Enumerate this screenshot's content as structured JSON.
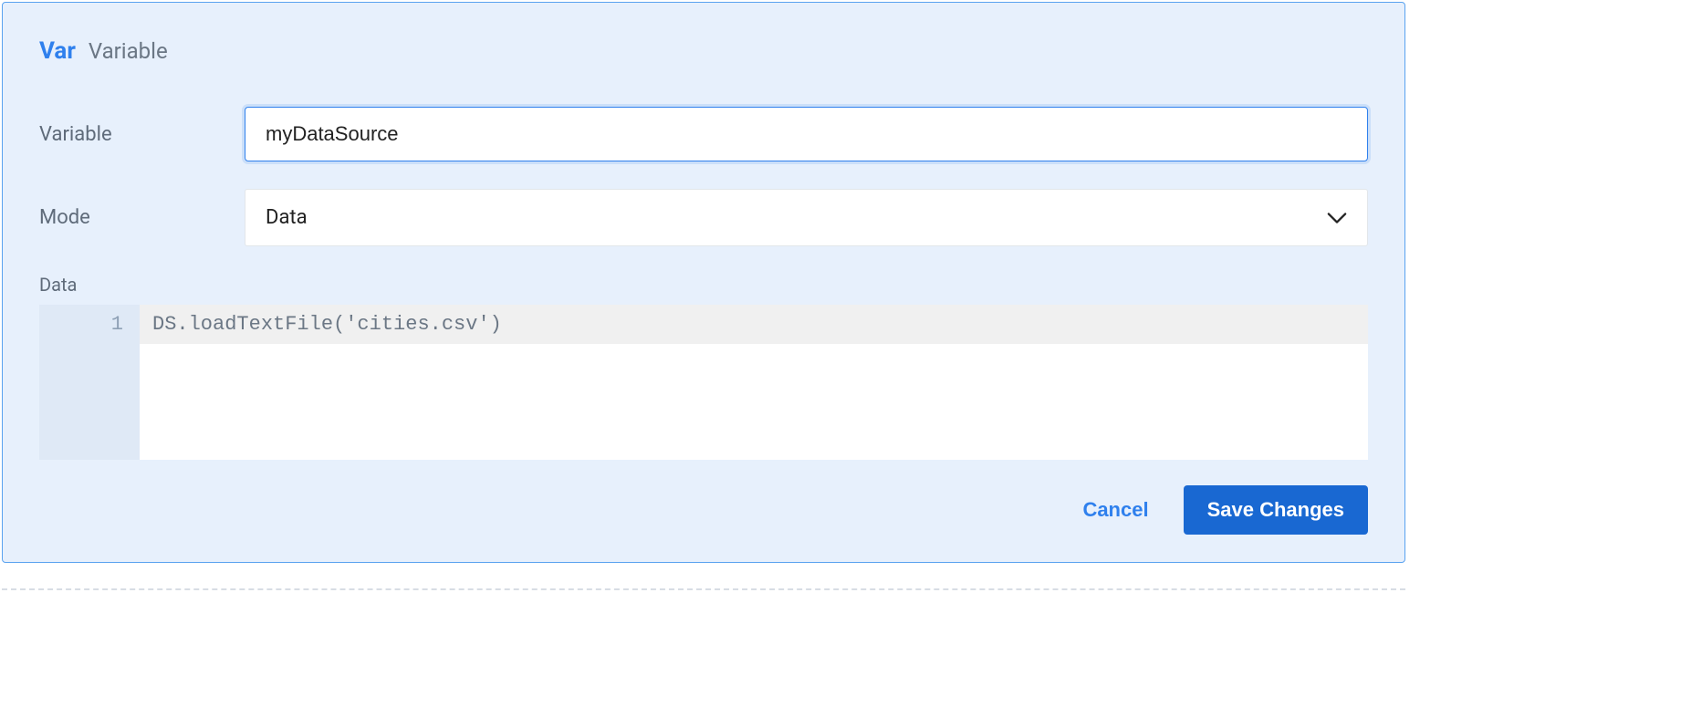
{
  "header": {
    "tag": "Var",
    "subtitle": "Variable"
  },
  "form": {
    "variable_label": "Variable",
    "variable_value": "myDataSource",
    "mode_label": "Mode",
    "mode_value": "Data",
    "data_label": "Data"
  },
  "editor": {
    "gutter": [
      "1"
    ],
    "lines": [
      "DS.loadTextFile('cities.csv')"
    ]
  },
  "actions": {
    "cancel": "Cancel",
    "save": "Save Changes"
  }
}
